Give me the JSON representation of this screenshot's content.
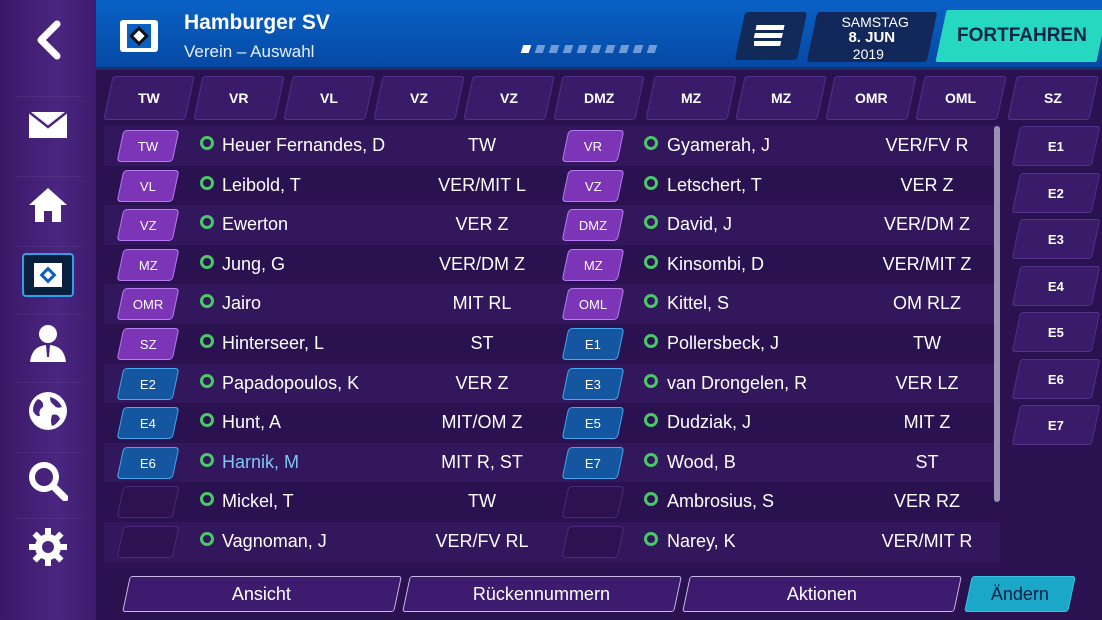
{
  "header": {
    "title": "Hamburger SV",
    "subtitle": "Verein – Auswahl",
    "date_day": "SAMSTAG",
    "date_main": "8. JUN",
    "date_year": "2019",
    "continue_label": "FORTFAHREN",
    "page_dots": 10,
    "active_dot": 1
  },
  "sidebar": {
    "items": [
      {
        "name": "mail-icon"
      },
      {
        "name": "home-icon"
      },
      {
        "name": "club-icon"
      },
      {
        "name": "person-icon"
      },
      {
        "name": "globe-icon"
      },
      {
        "name": "search-icon"
      },
      {
        "name": "gear-icon"
      }
    ],
    "active": 2
  },
  "columns": [
    "TW",
    "VR",
    "VL",
    "VZ",
    "VZ",
    "DMZ",
    "MZ",
    "MZ",
    "OMR",
    "OML",
    "SZ"
  ],
  "left_rows": [
    {
      "pos": "TW",
      "style": "purple",
      "name": "Heuer Fernandes, D",
      "role": "TW"
    },
    {
      "pos": "VL",
      "style": "purple",
      "name": "Leibold, T",
      "role": "VER/MIT L"
    },
    {
      "pos": "VZ",
      "style": "purple",
      "name": "Ewerton",
      "role": "VER Z"
    },
    {
      "pos": "MZ",
      "style": "purple",
      "name": "Jung, G",
      "role": "VER/DM Z"
    },
    {
      "pos": "OMR",
      "style": "purple",
      "name": "Jairo",
      "role": "MIT RL"
    },
    {
      "pos": "SZ",
      "style": "purple",
      "name": "Hinterseer, L",
      "role": "ST"
    },
    {
      "pos": "E2",
      "style": "blue",
      "name": "Papadopoulos, K",
      "role": "VER Z"
    },
    {
      "pos": "E4",
      "style": "blue",
      "name": "Hunt, A",
      "role": "MIT/OM Z"
    },
    {
      "pos": "E6",
      "style": "blue",
      "name": "Harnik, M",
      "role": "MIT R, ST",
      "highlight": true
    },
    {
      "pos": "",
      "style": "empty",
      "name": "Mickel, T",
      "role": "TW"
    },
    {
      "pos": "",
      "style": "empty",
      "name": "Vagnoman, J",
      "role": "VER/FV RL"
    }
  ],
  "right_rows": [
    {
      "pos": "VR",
      "style": "purple",
      "name": "Gyamerah, J",
      "role": "VER/FV R"
    },
    {
      "pos": "VZ",
      "style": "purple",
      "name": "Letschert, T",
      "role": "VER Z"
    },
    {
      "pos": "DMZ",
      "style": "purple",
      "name": "David, J",
      "role": "VER/DM Z"
    },
    {
      "pos": "MZ",
      "style": "purple",
      "name": "Kinsombi, D",
      "role": "VER/MIT Z"
    },
    {
      "pos": "OML",
      "style": "purple",
      "name": "Kittel, S",
      "role": "OM RLZ"
    },
    {
      "pos": "E1",
      "style": "blue",
      "name": "Pollersbeck, J",
      "role": "TW"
    },
    {
      "pos": "E3",
      "style": "blue",
      "name": "van Drongelen, R",
      "role": "VER LZ"
    },
    {
      "pos": "E5",
      "style": "blue",
      "name": "Dudziak, J",
      "role": "MIT Z"
    },
    {
      "pos": "E7",
      "style": "blue",
      "name": "Wood, B",
      "role": "ST"
    },
    {
      "pos": "",
      "style": "empty",
      "name": "Ambrosius, S",
      "role": "VER RZ"
    },
    {
      "pos": "",
      "style": "empty",
      "name": "Narey, K",
      "role": "VER/MIT R"
    }
  ],
  "subs": [
    "E1",
    "E2",
    "E3",
    "E4",
    "E5",
    "E6",
    "E7"
  ],
  "footer": {
    "view_label": "Ansicht",
    "numbers_label": "Rückennummern",
    "actions_label": "Aktionen",
    "change_label": "Ändern"
  }
}
